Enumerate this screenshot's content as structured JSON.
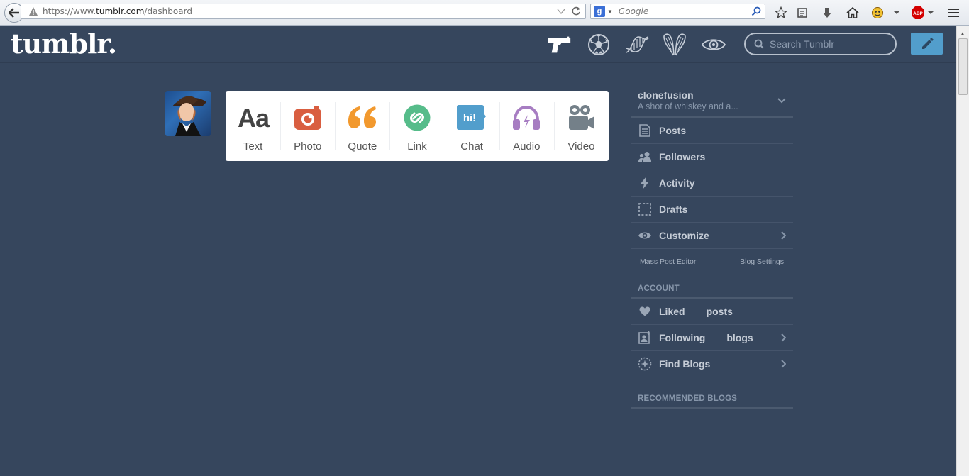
{
  "browser": {
    "url_prefix": "https://www.",
    "url_domain": "tumblr.com",
    "url_path": "/dashboard",
    "search_engine_icon": "g-icon",
    "search_placeholder": "Google"
  },
  "header": {
    "logo": "tumblr.",
    "search_placeholder": "Search Tumblr",
    "nav_icons": [
      "pistol-icon",
      "soccer-ball-icon",
      "dna-icon",
      "wings-icon",
      "eye-icon"
    ]
  },
  "post_types": [
    {
      "label": "Text",
      "icon": "text-icon",
      "color": "#444444"
    },
    {
      "label": "Photo",
      "icon": "camera-icon",
      "color": "#d95e40"
    },
    {
      "label": "Quote",
      "icon": "quote-icon",
      "color": "#f2992e"
    },
    {
      "label": "Link",
      "icon": "link-icon",
      "color": "#56bc8a"
    },
    {
      "label": "Chat",
      "icon": "chat-icon",
      "color": "#529ecc"
    },
    {
      "label": "Audio",
      "icon": "headphones-icon",
      "color": "#a77dc2"
    },
    {
      "label": "Video",
      "icon": "video-camera-icon",
      "color": "#748089"
    }
  ],
  "sidebar": {
    "blog_name": "clonefusion",
    "blog_description": "A shot of whiskey and a...",
    "items": [
      {
        "label": "Posts",
        "icon": "document-icon"
      },
      {
        "label": "Followers",
        "icon": "people-icon"
      },
      {
        "label": "Activity",
        "icon": "lightning-icon"
      },
      {
        "label": "Drafts",
        "icon": "dashed-square-icon"
      },
      {
        "label": "Customize",
        "icon": "eye-icon"
      }
    ],
    "mass_post_editor": "Mass Post Editor",
    "blog_settings": "Blog Settings",
    "account_heading": "ACCOUNT",
    "account_items": [
      {
        "label_a": "Liked",
        "label_b": "posts",
        "icon": "heart-icon"
      },
      {
        "label_a": "Following",
        "label_b": "blogs",
        "icon": "person-plus-icon"
      },
      {
        "label_a": "Find Blogs",
        "label_b": "",
        "icon": "sparkle-circle-icon"
      }
    ],
    "recommended_heading": "RECOMMENDED BLOGS"
  },
  "colors": {
    "background": "#36465d",
    "compose": "#529ecc"
  }
}
